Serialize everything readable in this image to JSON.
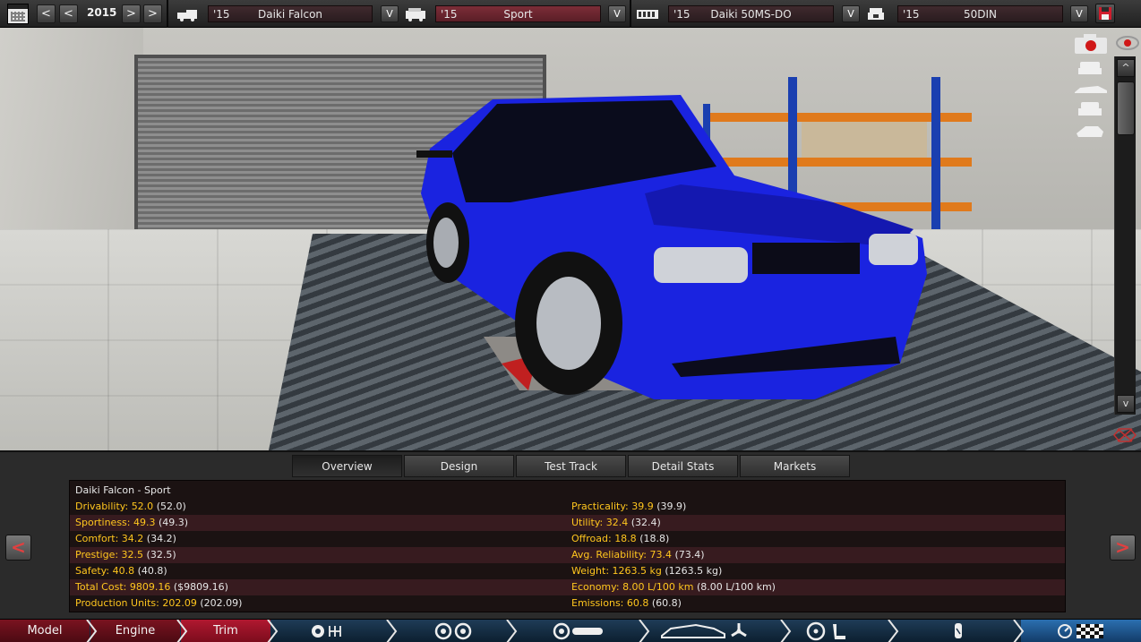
{
  "toolbar": {
    "year": "2015",
    "prev_fast": "<",
    "prev": "<",
    "next": ">",
    "next_fast": ">",
    "model_select": {
      "year": "'15",
      "name": "Daiki Falcon",
      "dropdown": "V"
    },
    "trim_select": {
      "year": "'15",
      "name": "Sport",
      "dropdown": "V"
    },
    "engine_select": {
      "year": "'15",
      "name": "Daiki 50MS-DO",
      "dropdown": "V"
    },
    "engine_variant_select": {
      "year": "'15",
      "name": "50DIN",
      "dropdown": "V"
    }
  },
  "viewport": {
    "scroll_up": "^",
    "scroll_down": "v",
    "car_color": "#1a23e0"
  },
  "panel": {
    "tabs": [
      "Overview",
      "Design",
      "Test Track",
      "Detail Stats",
      "Markets"
    ],
    "active_tab": "Overview",
    "nav_prev": "<",
    "nav_next": ">",
    "title": "Daiki Falcon - Sport",
    "left_stats": [
      {
        "label": "Drivability:",
        "value": "52.0",
        "prev": "(52.0)"
      },
      {
        "label": "Sportiness:",
        "value": "49.3",
        "prev": "(49.3)"
      },
      {
        "label": "Comfort:",
        "value": "34.2",
        "prev": "(34.2)"
      },
      {
        "label": "Prestige:",
        "value": "32.5",
        "prev": "(32.5)"
      },
      {
        "label": "Safety:",
        "value": "40.8",
        "prev": "(40.8)"
      },
      {
        "label": "Total Cost:",
        "value": "9809.16",
        "prev": "($9809.16)"
      },
      {
        "label": "Production Units:",
        "value": "202.09",
        "prev": "(202.09)"
      }
    ],
    "right_stats": [
      {
        "label": "Practicality:",
        "value": "39.9",
        "prev": "(39.9)"
      },
      {
        "label": "Utility:",
        "value": "32.4",
        "prev": "(32.4)"
      },
      {
        "label": "Offroad:",
        "value": "18.8",
        "prev": "(18.8)"
      },
      {
        "label": "Avg. Reliability:",
        "value": "73.4",
        "prev": "(73.4)"
      },
      {
        "label": "Weight:",
        "value": "1263.5 kg",
        "prev": "(1263.5 kg)"
      },
      {
        "label": "Economy:",
        "value": "8.00 L/100 km",
        "prev": "(8.00 L/100 km)"
      },
      {
        "label": "Emissions:",
        "value": "60.8",
        "prev": "(60.8)"
      }
    ]
  },
  "bottom_nav": {
    "model": "Model",
    "engine": "Engine",
    "trim": "Trim"
  }
}
